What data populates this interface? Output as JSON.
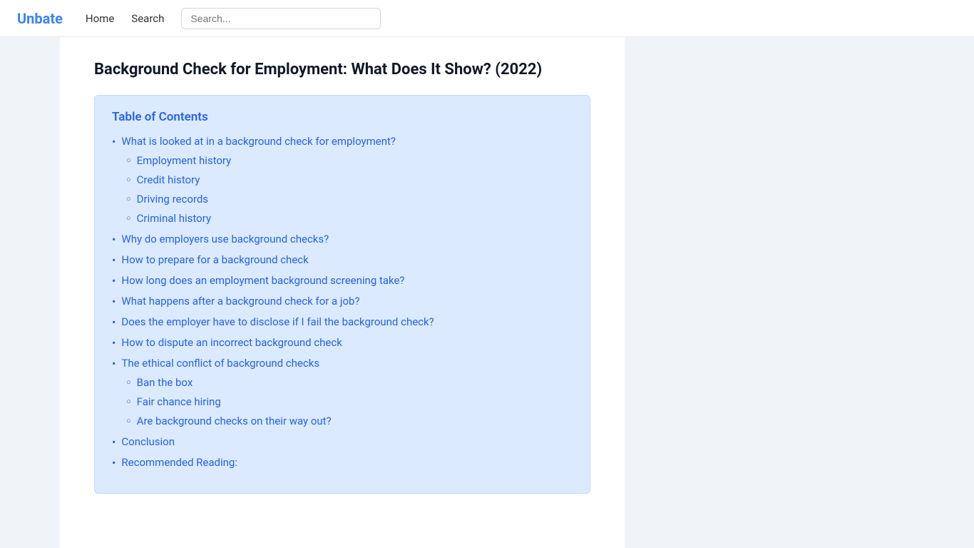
{
  "navbar": {
    "logo": "Unbate",
    "links": [
      {
        "label": "Home"
      },
      {
        "label": "Search"
      }
    ],
    "search_placeholder": "Search..."
  },
  "page": {
    "title": "Background Check for Employment: What Does It Show? (2022)",
    "toc": {
      "heading": "Table of Contents",
      "items": [
        {
          "label": "What is looked at in a background check for employment?",
          "level": 1,
          "children": [
            {
              "label": "Employment history",
              "level": 2
            },
            {
              "label": "Credit history",
              "level": 2
            },
            {
              "label": "Driving records",
              "level": 2
            },
            {
              "label": "Criminal history",
              "level": 2
            }
          ]
        },
        {
          "label": "Why do employers use background checks?",
          "level": 1
        },
        {
          "label": "How to prepare for a background check",
          "level": 1
        },
        {
          "label": "How long does an employment background screening take?",
          "level": 1
        },
        {
          "label": "What happens after a background check for a job?",
          "level": 1
        },
        {
          "label": "Does the employer have to disclose if I fail the background check?",
          "level": 1
        },
        {
          "label": "How to dispute an incorrect background check",
          "level": 1
        },
        {
          "label": "The ethical conflict of background checks",
          "level": 1,
          "children": [
            {
              "label": "Ban the box",
              "level": 2
            },
            {
              "label": "Fair chance hiring",
              "level": 2
            },
            {
              "label": "Are background checks on their way out?",
              "level": 2
            }
          ]
        },
        {
          "label": "Conclusion",
          "level": 1
        },
        {
          "label": "Recommended Reading:",
          "level": 1
        }
      ]
    }
  }
}
